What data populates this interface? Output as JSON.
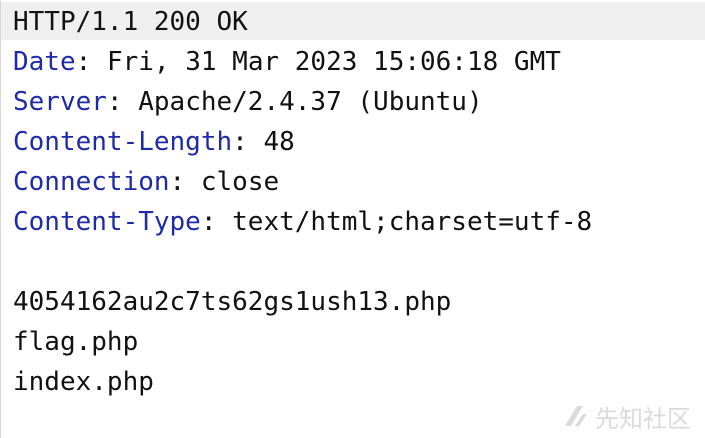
{
  "response": {
    "status_line": "HTTP/1.1 200 OK",
    "headers": [
      {
        "key": "Date",
        "value": "Fri, 31 Mar 2023 15:06:18 GMT"
      },
      {
        "key": "Server",
        "value": "Apache/2.4.37 (Ubuntu)"
      },
      {
        "key": "Content-Length",
        "value": "48"
      },
      {
        "key": "Connection",
        "value": "close"
      },
      {
        "key": "Content-Type",
        "value": "text/html;charset=utf-8"
      }
    ],
    "body_lines": [
      "4054162au2c7ts62gs1ush13.php",
      "flag.php",
      "index.php"
    ]
  },
  "watermark": {
    "text": "先知社区",
    "icon": "xianzhi-logo-icon"
  },
  "colors": {
    "header_key": "#1f2aa8",
    "text": "#111111",
    "status_bg": "#efefef"
  }
}
